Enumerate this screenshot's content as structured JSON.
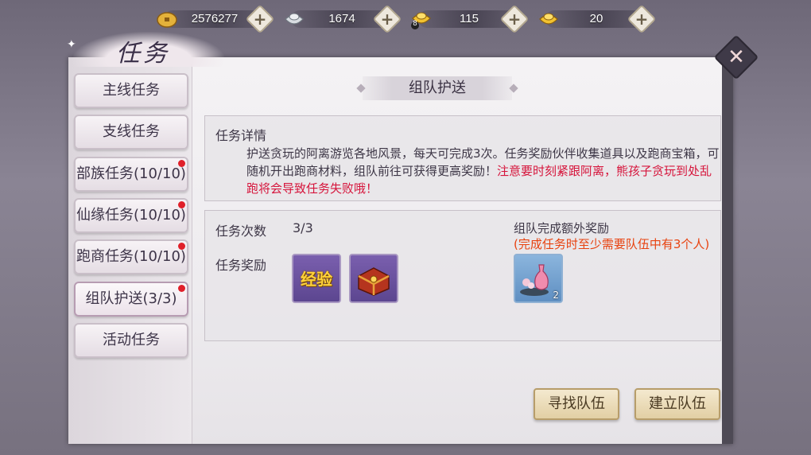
{
  "currency": [
    {
      "icon": "copper-coin-icon",
      "value": "2576277"
    },
    {
      "icon": "silver-ingot-icon",
      "value": "1674"
    },
    {
      "icon": "gold-ingot-badge-icon",
      "value": "115",
      "badge": "8"
    },
    {
      "icon": "gold-ingot-icon",
      "value": "20"
    }
  ],
  "plus_label": "+",
  "window": {
    "title": "任务",
    "close_label": "✕"
  },
  "tabs": [
    {
      "label": "主线任务",
      "dot": false,
      "active": false
    },
    {
      "label": "支线任务",
      "dot": false,
      "active": false
    },
    {
      "label": "部族任务(10/10)",
      "dot": true,
      "active": false
    },
    {
      "label": "仙缘任务(10/10)",
      "dot": true,
      "active": false
    },
    {
      "label": "跑商任务(10/10)",
      "dot": true,
      "active": false
    },
    {
      "label": "组队护送(3/3)",
      "dot": true,
      "active": true
    },
    {
      "label": "活动任务",
      "dot": false,
      "active": false
    }
  ],
  "section": {
    "title": "组队护送"
  },
  "details": {
    "heading": "任务详情",
    "text": "护送贪玩的阿离游览各地风景，每天可完成3次。任务奖励伙伴收集道具以及跑商宝箱，可随机开出跑商材料，组队前往可获得更高奖励！",
    "warning": "注意要时刻紧跟阿离，熊孩子贪玩到处乱跑将会导致任务失败哦！"
  },
  "task": {
    "count_label": "任务次数",
    "count_value": "3/3",
    "reward_label": "任务奖励",
    "rewards": [
      {
        "icon": "exp-icon",
        "text": "经验"
      },
      {
        "icon": "treasure-chest-icon"
      }
    ]
  },
  "team_bonus": {
    "title": "组队完成额外奖励",
    "note": "(完成任务时至少需要队伍中有3个人)",
    "item": {
      "icon": "flower-vase-icon",
      "count": "2"
    }
  },
  "buttons": {
    "find_team": "寻找队伍",
    "create_team": "建立队伍"
  },
  "colors": {
    "warning": "#d6143b",
    "note": "#e8420f",
    "badge_dot": "#e0202a"
  }
}
